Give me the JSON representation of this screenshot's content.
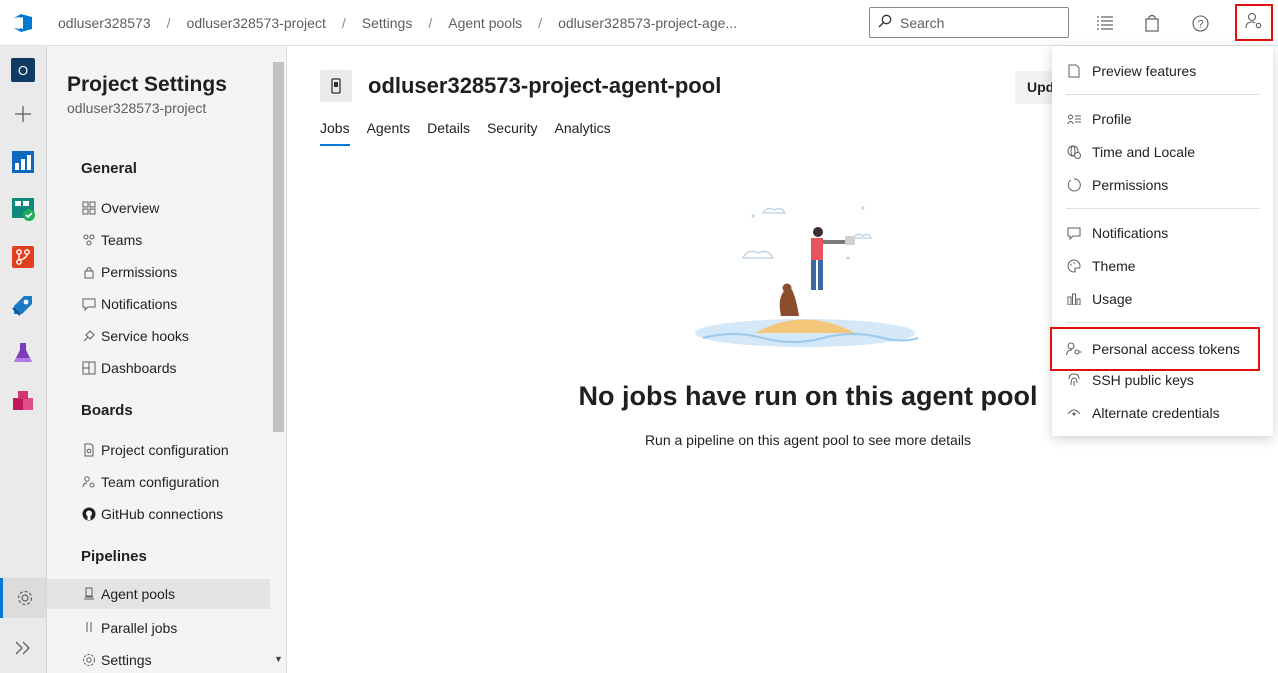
{
  "breadcrumbs": [
    "odluser328573",
    "odluser328573-project",
    "Settings",
    "Agent pools",
    "odluser328573-project-age..."
  ],
  "search": {
    "placeholder": "Search"
  },
  "settings_nav": {
    "title": "Project Settings",
    "subtitle": "odluser328573-project",
    "sections": [
      {
        "label": "General",
        "items": [
          "Overview",
          "Teams",
          "Permissions",
          "Notifications",
          "Service hooks",
          "Dashboards"
        ]
      },
      {
        "label": "Boards",
        "items": [
          "Project configuration",
          "Team configuration",
          "GitHub connections"
        ]
      },
      {
        "label": "Pipelines",
        "items": [
          "Agent pools",
          "Parallel jobs",
          "Settings"
        ]
      }
    ],
    "selected_item": "Agent pools"
  },
  "rail": {
    "org_initial": "O"
  },
  "main": {
    "title": "odluser328573-project-agent-pool",
    "update_button": "Upd",
    "tabs": [
      "Jobs",
      "Agents",
      "Details",
      "Security",
      "Analytics"
    ],
    "active_tab": "Jobs",
    "empty_title": "No jobs have run on this agent pool",
    "empty_subtitle": "Run a pipeline on this agent pool to see more details"
  },
  "user_menu": {
    "groups": [
      [
        "Preview features"
      ],
      [
        "Profile",
        "Time and Locale",
        "Permissions"
      ],
      [
        "Notifications",
        "Theme",
        "Usage"
      ],
      [
        "Personal access tokens",
        "SSH public keys",
        "Alternate credentials"
      ]
    ],
    "highlighted": "Personal access tokens"
  },
  "colors": {
    "accent": "#0078d4",
    "highlight_border": "#e01010"
  }
}
